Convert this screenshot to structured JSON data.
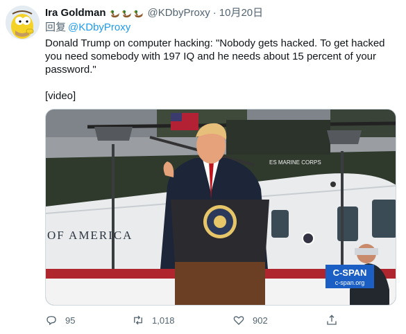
{
  "author": {
    "display_name": "Ira Goldman",
    "handle": "@KDbyProxy",
    "date": "10月20日",
    "badges": [
      "duck-emoji",
      "duck-emoji",
      "duck-emoji"
    ]
  },
  "reply": {
    "prefix": "回复",
    "mention": "@KDbyProxy"
  },
  "tweet": {
    "text": "Donald Trump on computer hacking: \"Nobody gets hacked. To get hacked you need somebody with 197 IQ and he needs about 15 percent of your password.\"",
    "video_label": "[video]"
  },
  "media": {
    "helicopter_text": "OF AMERICA",
    "marine_text": "ES MARINE CORPS",
    "network_logo": "C-SPAN",
    "network_url": "c-span.org"
  },
  "actions": {
    "reply_count": "95",
    "retweet_count": "1,018",
    "like_count": "902",
    "reply_icon": "reply-icon",
    "retweet_icon": "retweet-icon",
    "like_icon": "heart-icon",
    "share_icon": "share-icon"
  },
  "colors": {
    "link": "#1d9bf0",
    "muted": "#536471",
    "cspan_blue": "#1b5fc4"
  }
}
